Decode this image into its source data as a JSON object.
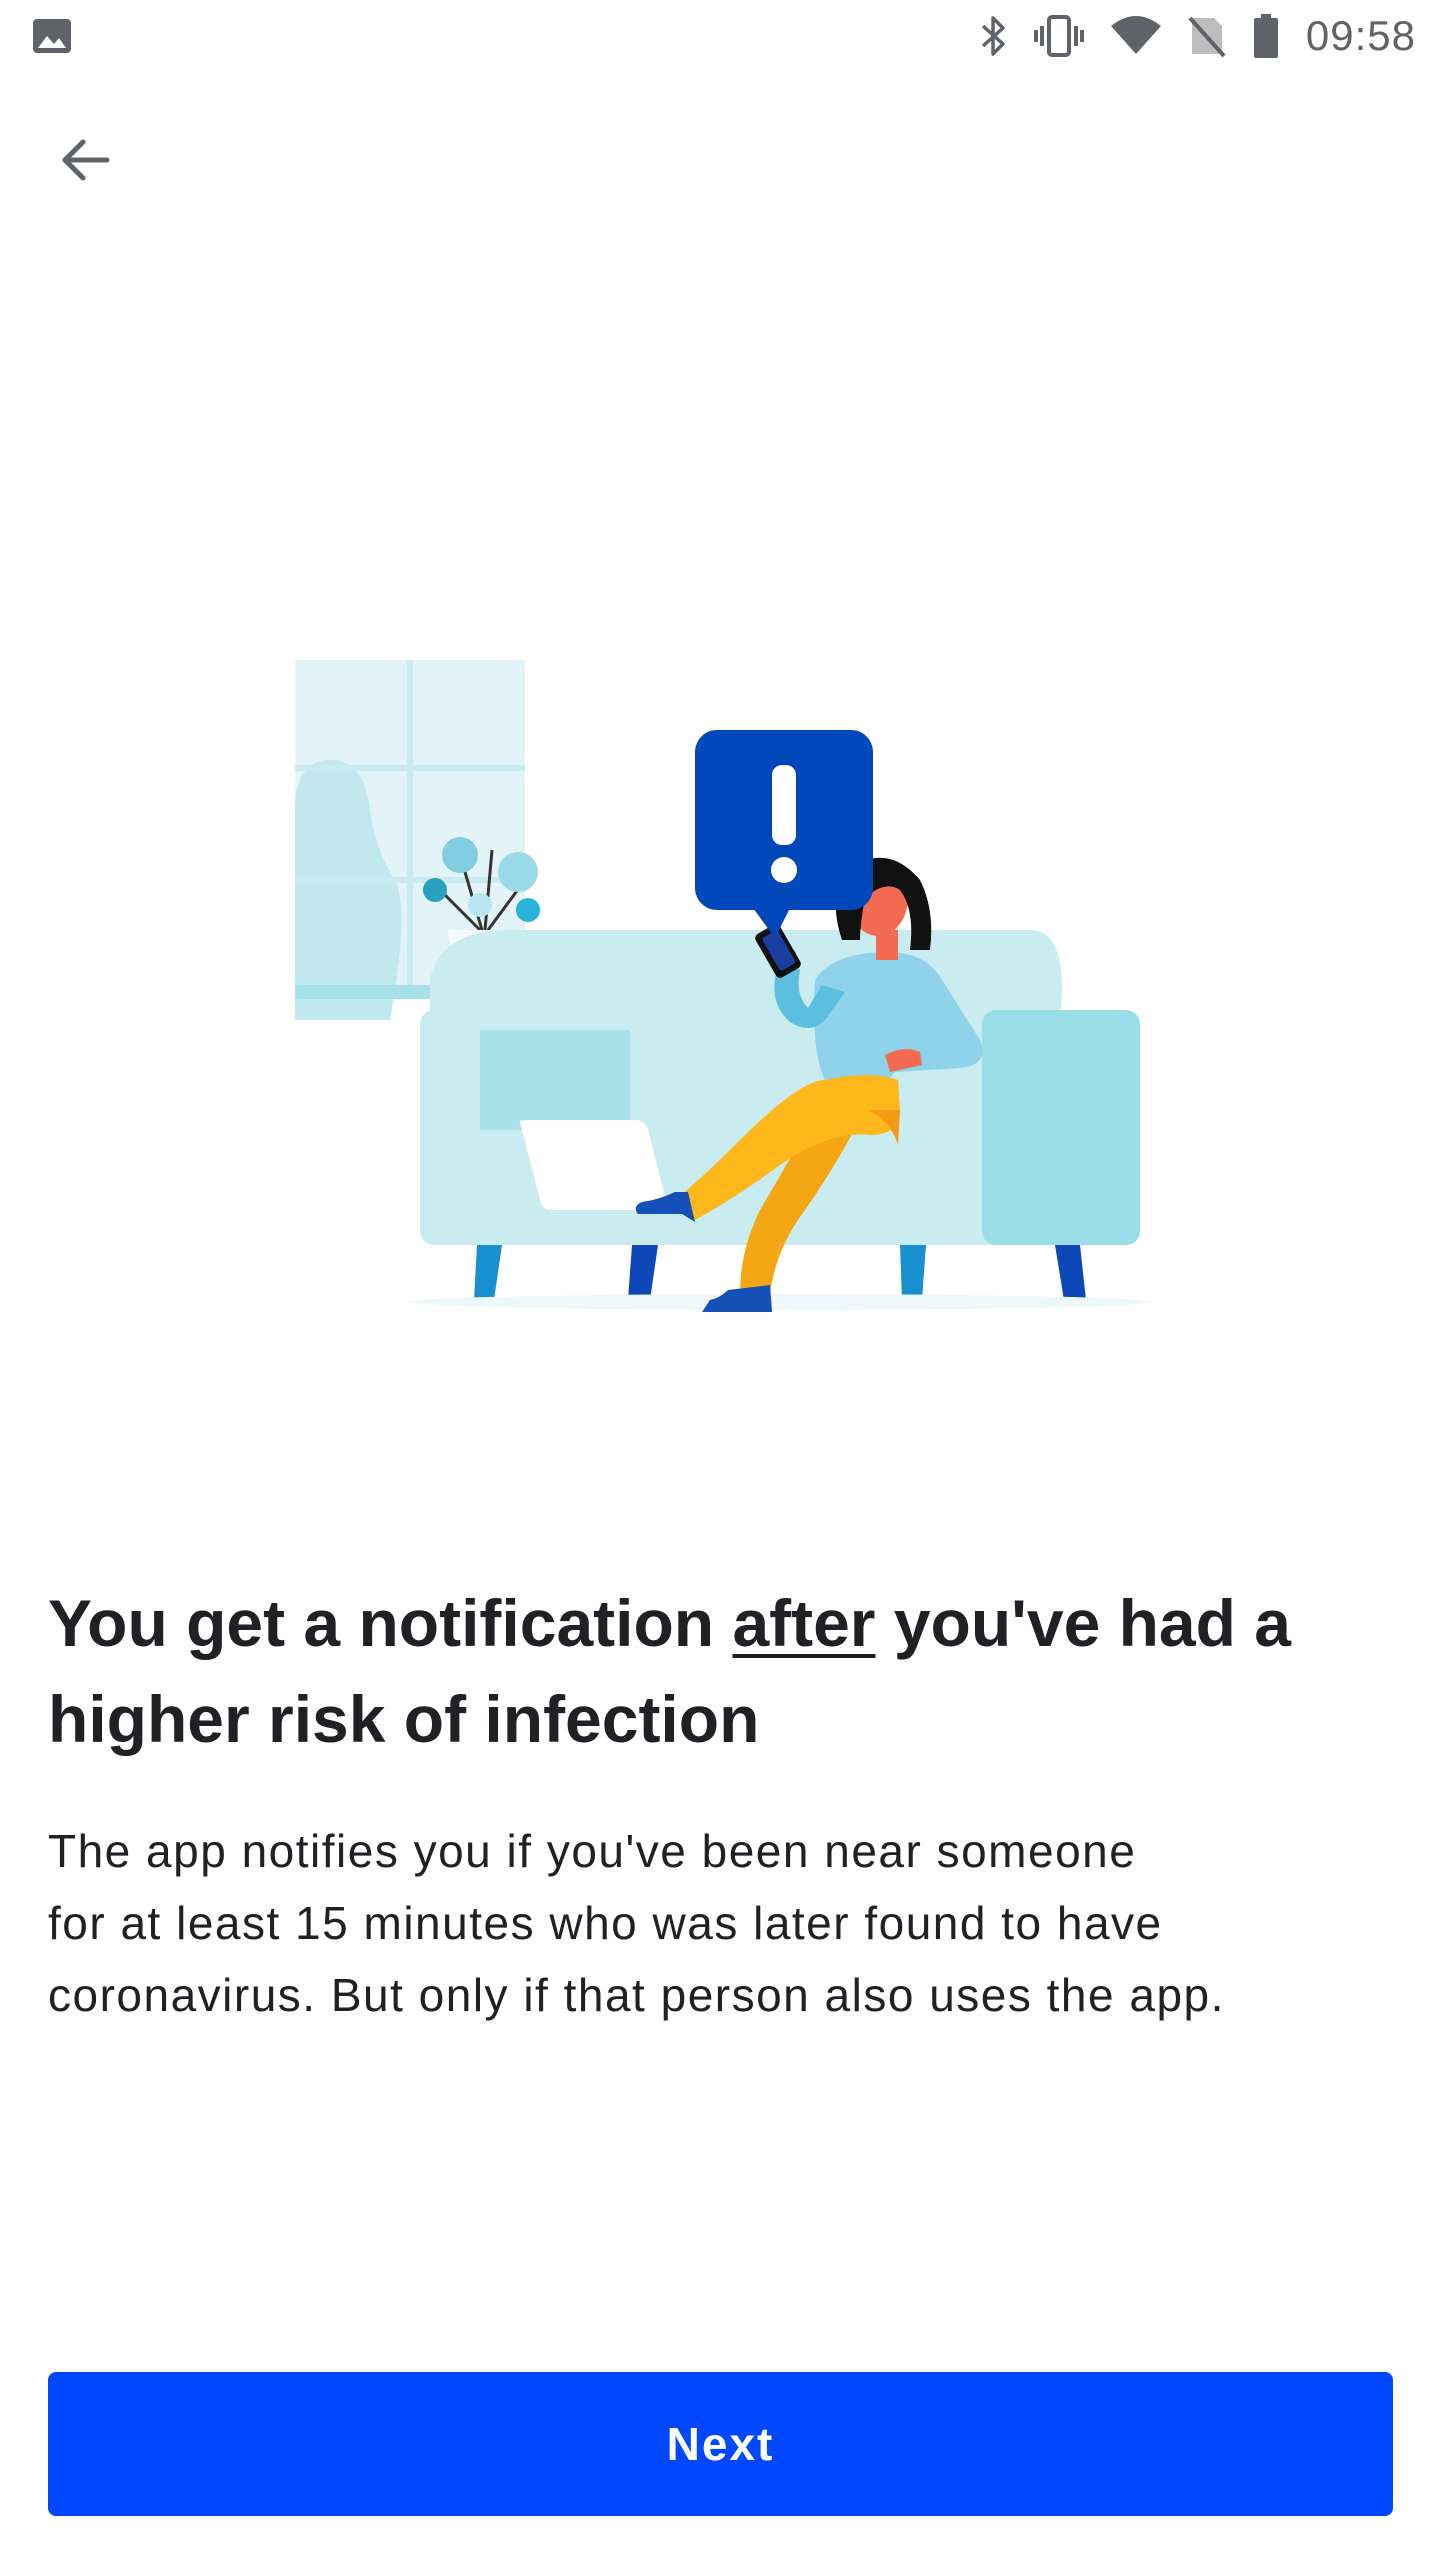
{
  "status_bar": {
    "time": "09:58",
    "left_icon": "image-icon",
    "right_icons": [
      "bluetooth-icon",
      "vibrate-icon",
      "wifi-icon",
      "no-sim-icon",
      "battery-icon"
    ]
  },
  "nav": {
    "back_icon": "arrow-left-icon"
  },
  "content": {
    "headline_part1": "You get a notification ",
    "headline_emphasis": "after",
    "headline_part2": " you've had a higher risk of infection",
    "body_line1": "The app notifies you if you've been near someone",
    "body_line2": "for at least 15 minutes who was later found to have",
    "body_line3": "coronavirus. But only if that person also uses the app."
  },
  "actions": {
    "next_label": "Next"
  },
  "colors": {
    "primary": "#0048ff",
    "text": "#202124",
    "icon_gray": "#5f6368",
    "alert_blue": "#0047bb",
    "sofa": "#c8ecf0",
    "sofa_dark": "#99dde6",
    "pants": "#ffb81c",
    "shirt": "#8fd3ea",
    "skin": "#f26b52"
  }
}
